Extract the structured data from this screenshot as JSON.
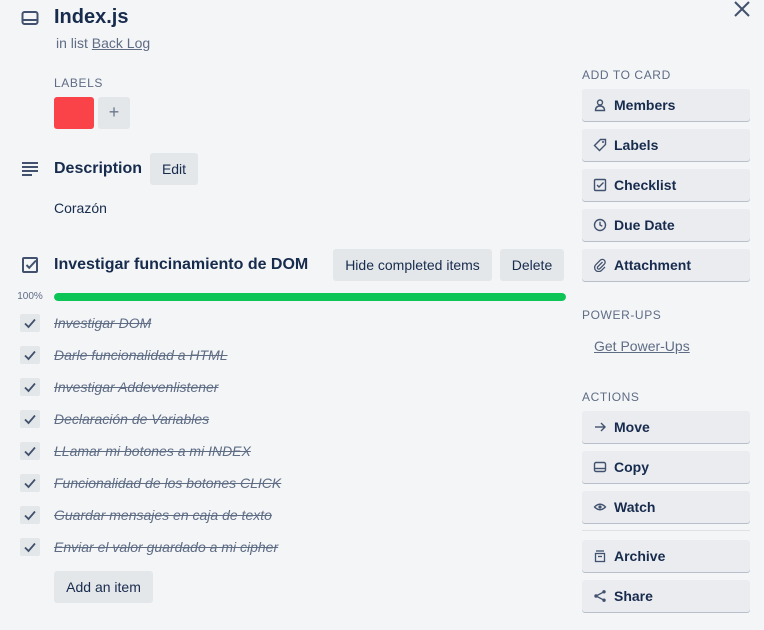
{
  "card": {
    "title": "Index.js",
    "list_prefix": "in list",
    "list_name": "Back Log"
  },
  "labels": {
    "heading": "LABELS",
    "items": [
      {
        "color": "#f94348"
      }
    ],
    "add_symbol": "+"
  },
  "description": {
    "heading": "Description",
    "edit_label": "Edit",
    "text": "Corazón"
  },
  "checklist": {
    "title": "Investigar funcinamiento de DOM",
    "hide_label": "Hide completed items",
    "delete_label": "Delete",
    "progress_label": "100%",
    "progress": 1.0,
    "progress_color": "#0cc556",
    "items": [
      {
        "text": "Investigar DOM",
        "done": true
      },
      {
        "text": "Darle funcionalidad a HTML",
        "done": true
      },
      {
        "text": "Investigar Addevenlistener",
        "done": true
      },
      {
        "text": "Declaración de Variables",
        "done": true
      },
      {
        "text": "LLamar mi botones a mi INDEX",
        "done": true
      },
      {
        "text": "Funcionalidad de los botones CLICK",
        "done": true
      },
      {
        "text": "Guardar mensajes en caja de texto",
        "done": true
      },
      {
        "text": "Enviar el valor guardado a mi cipher",
        "done": true
      }
    ],
    "add_item_label": "Add an item"
  },
  "sidebar": {
    "add_heading": "ADD TO CARD",
    "add_buttons": [
      {
        "label": "Members",
        "icon": "person-icon"
      },
      {
        "label": "Labels",
        "icon": "tag-icon"
      },
      {
        "label": "Checklist",
        "icon": "checkbox-icon"
      },
      {
        "label": "Due Date",
        "icon": "clock-icon"
      },
      {
        "label": "Attachment",
        "icon": "paperclip-icon"
      }
    ],
    "powerups_heading": "POWER-UPS",
    "powerups_link": "Get Power-Ups",
    "actions_heading": "ACTIONS",
    "action_buttons": [
      {
        "label": "Move",
        "icon": "arrow-right-icon"
      },
      {
        "label": "Copy",
        "icon": "card-icon"
      },
      {
        "label": "Watch",
        "icon": "eye-icon"
      },
      {
        "label": "Archive",
        "icon": "archive-icon"
      },
      {
        "label": "Share",
        "icon": "share-icon"
      }
    ]
  }
}
